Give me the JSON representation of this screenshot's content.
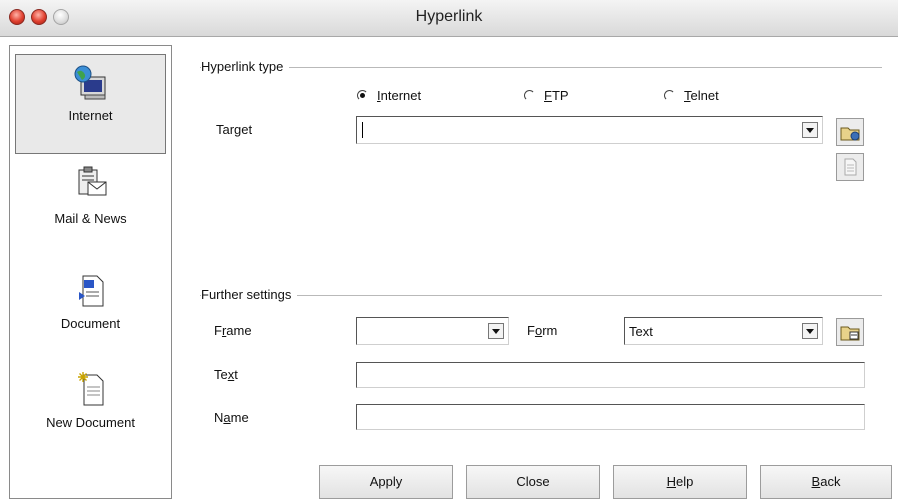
{
  "window": {
    "title": "Hyperlink"
  },
  "sidebar": {
    "items": [
      {
        "label": "Internet",
        "icon": "globe-computer-icon",
        "selected": true
      },
      {
        "label": "Mail & News",
        "icon": "mail-clipboard-icon",
        "selected": false
      },
      {
        "label": "Document",
        "icon": "document-icon",
        "selected": false
      },
      {
        "label": "New Document",
        "icon": "new-document-icon",
        "selected": false
      }
    ]
  },
  "hyperlink_type": {
    "heading": "Hyperlink type",
    "options": [
      {
        "pre": "",
        "ul": "I",
        "post": "nternet",
        "checked": true
      },
      {
        "pre": "",
        "ul": "F",
        "post": "TP",
        "checked": false
      },
      {
        "pre": "",
        "ul": "T",
        "post": "elnet",
        "checked": false
      }
    ],
    "target_label": "Target",
    "target_value": ""
  },
  "further_settings": {
    "heading": "Further settings",
    "frame": {
      "pre": "F",
      "ul": "r",
      "post": "ame",
      "value": ""
    },
    "form": {
      "pre": "F",
      "ul": "o",
      "post": "rm",
      "value": "Text"
    },
    "text": {
      "pre": "Te",
      "ul": "x",
      "post": "t",
      "value": ""
    },
    "name": {
      "pre": "N",
      "ul": "a",
      "post": "me",
      "value": ""
    }
  },
  "buttons": {
    "apply": {
      "pre": "",
      "ul": "",
      "post": "Apply"
    },
    "close": {
      "pre": "",
      "ul": "",
      "post": "Close"
    },
    "help": {
      "pre": "",
      "ul": "H",
      "post": "elp"
    },
    "back": {
      "pre": "",
      "ul": "B",
      "post": "ack"
    }
  },
  "colors": {
    "titlebar": "#dcdcdc",
    "close_light": "#e0402f",
    "border": "#8a8a8a"
  }
}
